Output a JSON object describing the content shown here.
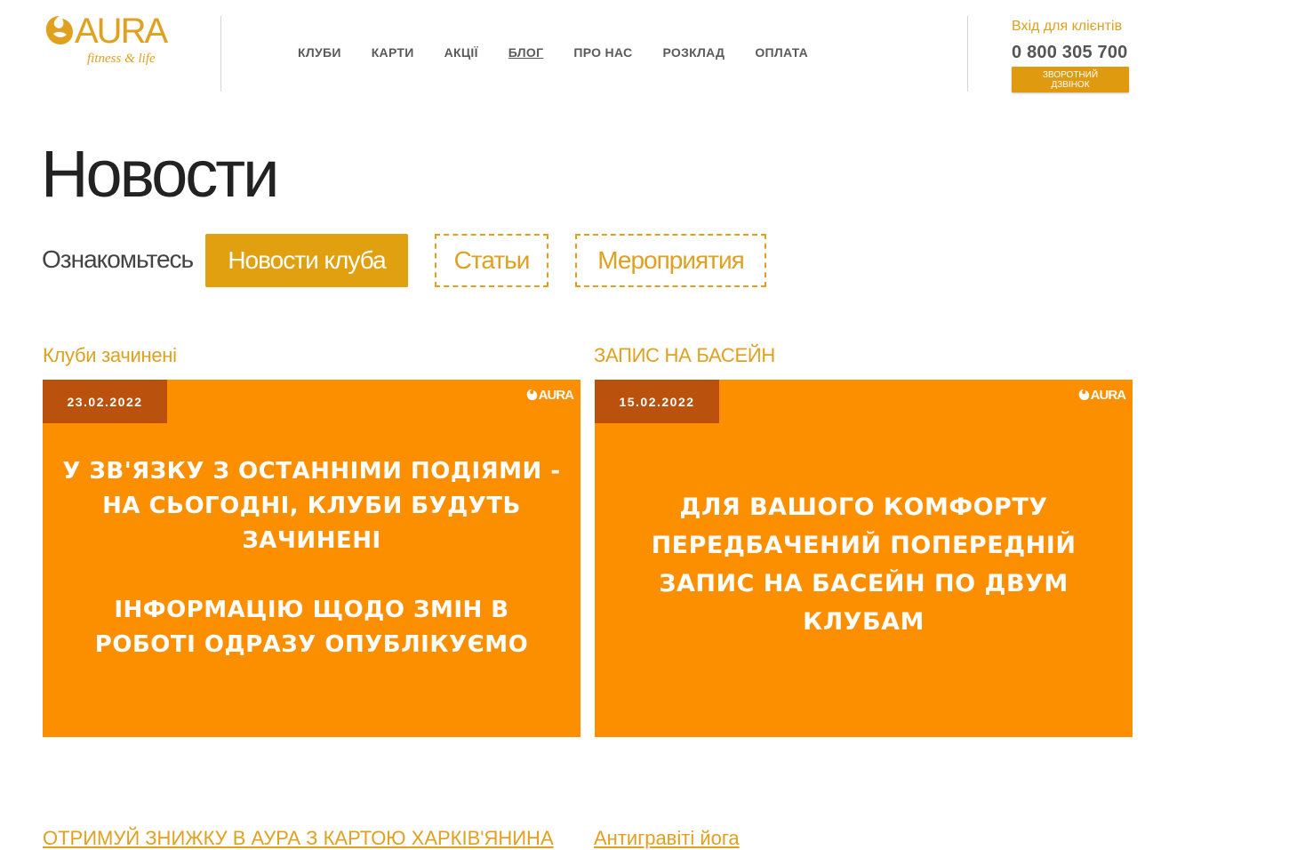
{
  "brand": {
    "name": "AURA",
    "tagline": "fitness & life",
    "accent": "#e0a020"
  },
  "nav": [
    {
      "label": "КЛУБИ"
    },
    {
      "label": "КАРТИ"
    },
    {
      "label": "АКЦІЇ"
    },
    {
      "label": "БЛОГ",
      "active": true
    },
    {
      "label": "ПРО НАС"
    },
    {
      "label": "РОЗКЛАД"
    },
    {
      "label": "ОПЛАТА"
    }
  ],
  "contact": {
    "login_label": "Вхід для клієнтів",
    "phone": "0 800 305 700",
    "callback_line1": "ЗВОРОТНИЙ",
    "callback_line2": "ДЗВІНОК"
  },
  "page": {
    "title": "Новости",
    "filter_label": "Ознакомьтесь",
    "filters": [
      "Новости клуба",
      "Статьи",
      "Мероприятия"
    ]
  },
  "posts": [
    {
      "title": "Клуби зачинені",
      "date": "23.02.2022",
      "image_logo": "AURA",
      "image_text_1": "у зв'язку з останніми подіями - на сьогодні, клуби будуть зачинені",
      "image_text_2": "інформацію щодо змін в роботі одразу опублікуємо"
    },
    {
      "title": "ЗАПИС НА БАСЕЙН",
      "date": "15.02.2022",
      "image_logo": "AURA",
      "image_text_1": "Для вашого комфорту передбачений попередній запис на басейн по двум клубам"
    }
  ],
  "more_posts": [
    {
      "title": "ОТРИМУЙ ЗНИЖКУ В АУРА З КАРТОЮ ХАРКІВ'ЯНИНА"
    },
    {
      "title": "Антигравіті йога"
    }
  ]
}
